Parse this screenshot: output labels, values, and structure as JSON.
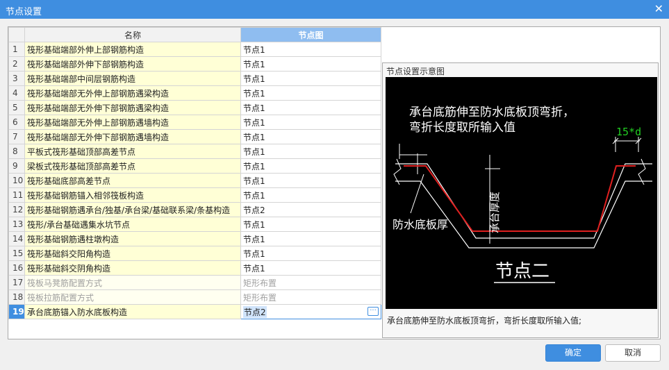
{
  "window": {
    "title": "节点设置",
    "close_glyph": "✕"
  },
  "table": {
    "headers": {
      "name": "名称",
      "node": "节点图"
    },
    "rows": [
      {
        "num": "1",
        "name": "筏形基础端部外伸上部钢筋构造",
        "node": "节点1",
        "disabled": false
      },
      {
        "num": "2",
        "name": "筏形基础端部外伸下部钢筋构造",
        "node": "节点1",
        "disabled": false
      },
      {
        "num": "3",
        "name": "筏形基础端部中间层钢筋构造",
        "node": "节点1",
        "disabled": false
      },
      {
        "num": "4",
        "name": "筏形基础端部无外伸上部钢筋遇梁构造",
        "node": "节点1",
        "disabled": false
      },
      {
        "num": "5",
        "name": "筏形基础端部无外伸下部钢筋遇梁构造",
        "node": "节点1",
        "disabled": false
      },
      {
        "num": "6",
        "name": "筏形基础端部无外伸上部钢筋遇墙构造",
        "node": "节点1",
        "disabled": false
      },
      {
        "num": "7",
        "name": "筏形基础端部无外伸下部钢筋遇墙构造",
        "node": "节点1",
        "disabled": false
      },
      {
        "num": "8",
        "name": "平板式筏形基础顶部高差节点",
        "node": "节点1",
        "disabled": false
      },
      {
        "num": "9",
        "name": "梁板式筏形基础顶部高差节点",
        "node": "节点1",
        "disabled": false
      },
      {
        "num": "10",
        "name": "筏形基础底部高差节点",
        "node": "节点1",
        "disabled": false
      },
      {
        "num": "11",
        "name": "筏形基础钢筋锚入相邻筏板构造",
        "node": "节点1",
        "disabled": false
      },
      {
        "num": "12",
        "name": "筏形基础钢筋遇承台/独基/承台梁/基础联系梁/条基构造",
        "node": "节点2",
        "disabled": false
      },
      {
        "num": "13",
        "name": "筏形/承台基础遇集水坑节点",
        "node": "节点1",
        "disabled": false
      },
      {
        "num": "14",
        "name": "筏形基础钢筋遇柱墩构造",
        "node": "节点1",
        "disabled": false
      },
      {
        "num": "15",
        "name": "筏形基础斜交阳角构造",
        "node": "节点1",
        "disabled": false
      },
      {
        "num": "16",
        "name": "筏形基础斜交阴角构造",
        "node": "节点1",
        "disabled": false
      },
      {
        "num": "17",
        "name": "筏板马凳筋配置方式",
        "node": "矩形布置",
        "disabled": true
      },
      {
        "num": "18",
        "name": "筏板拉筋配置方式",
        "node": "矩形布置",
        "disabled": true
      },
      {
        "num": "19",
        "name": "承台底筋锚入防水底板构造",
        "node": "节点2",
        "disabled": false,
        "current": true
      }
    ],
    "ellipsis_glyph": "···"
  },
  "preview": {
    "title": "节点设置示意图",
    "diagram": {
      "text_line1": "承台底筋伸至防水底板顶弯折，",
      "text_line2": "弯折长度取所输入值",
      "dim_label": "15*d",
      "thickness_label": "承台厚度",
      "waterproof_label": "防水底板厚",
      "node_title": "节点二",
      "colors": {
        "background": "#000000",
        "lines": "#ffffff",
        "rebar": "#e02020",
        "dimension": "#22cc22"
      }
    },
    "description": "承台底筋伸至防水底板顶弯折，弯折长度取所输入值;"
  },
  "buttons": {
    "ok": "确定",
    "cancel": "取消"
  }
}
